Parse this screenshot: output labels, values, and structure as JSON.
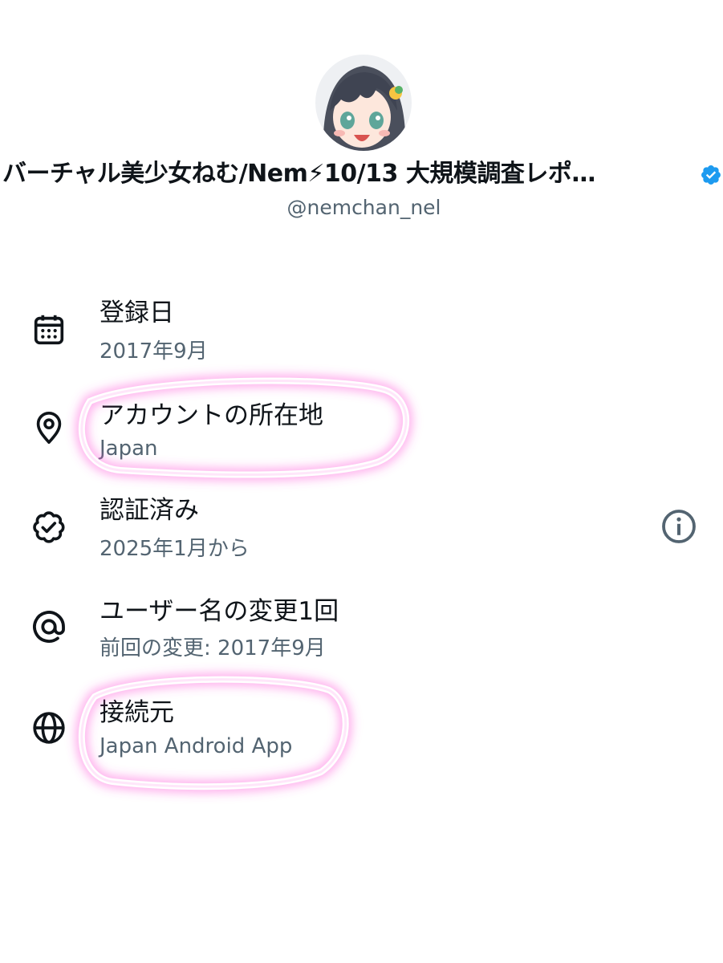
{
  "profile": {
    "display_name": "バーチャル美少女ねむ/Nem⚡10/13 大規模調査レポ…",
    "handle": "@nemchan_nel"
  },
  "rows": [
    {
      "title": "登録日",
      "value": "2017年9月",
      "icon": "calendar-icon"
    },
    {
      "title": "アカウントの所在地",
      "value": "Japan",
      "icon": "location-pin-icon"
    },
    {
      "title": "認証済み",
      "value": "2025年1月から",
      "icon": "verified-badge-icon"
    },
    {
      "title": "ユーザー名の変更1回",
      "value": "前回の変更: 2017年9月",
      "icon": "at-sign-icon"
    },
    {
      "title": "接続元",
      "value": "Japan Android App",
      "icon": "globe-icon"
    }
  ],
  "colors": {
    "text": "#0f1419",
    "secondary": "#536471",
    "verified": "#1d9bf0",
    "highlight": "#ff4fd8"
  }
}
